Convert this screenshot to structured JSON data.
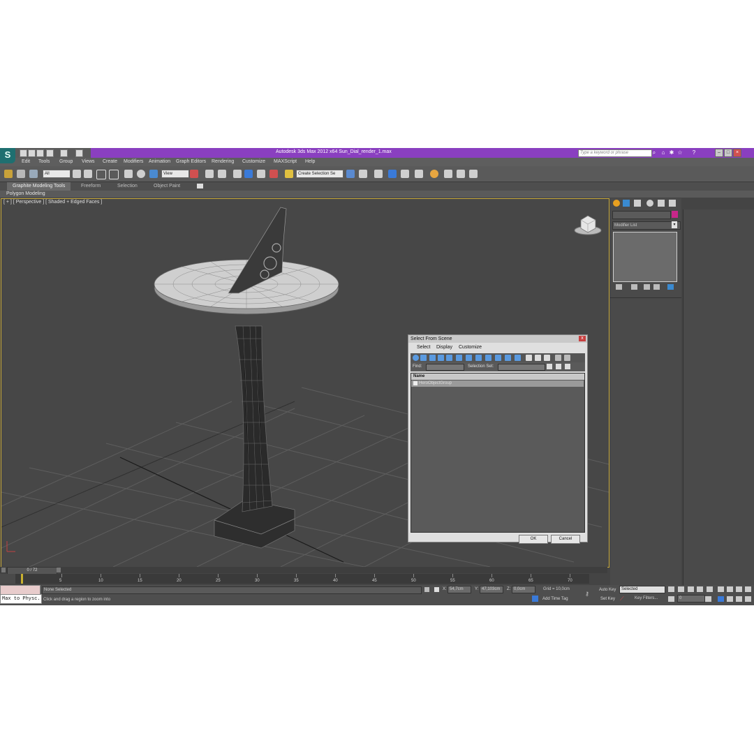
{
  "window": {
    "title": "Autodesk 3ds Max  2012 x64     Sun_Dial_render_1.max",
    "search_placeholder": "Type a keyword or phrase",
    "logo": "S"
  },
  "menu": [
    "Edit",
    "Tools",
    "Group",
    "Views",
    "Create",
    "Modifiers",
    "Animation",
    "Graph Editors",
    "Rendering",
    "Customize",
    "MAXScript",
    "Help"
  ],
  "toolbar": {
    "selection_filter": "All",
    "reference_coord": "View",
    "named_selection_set": "Create Selection Se"
  },
  "ribbon": {
    "tabs": [
      "Graphite Modeling Tools",
      "Freeform",
      "Selection",
      "Object Paint"
    ],
    "sub_label": "Polygon Modeling"
  },
  "viewport": {
    "label": "[ + ] [ Perspective ] [ Shaded + Edged Faces ]"
  },
  "command_panel": {
    "modifier_list": "Modifier List",
    "object_color": "#c8278a"
  },
  "dialog": {
    "title": "Select From Scene",
    "close": "x",
    "menu": [
      "Select",
      "Display",
      "Customize"
    ],
    "find_label": "Find:",
    "selection_set_label": "Selection Set:",
    "column_name": "Name",
    "items": [
      "HeroObjectGroup"
    ],
    "ok": "OK",
    "cancel": "Cancel"
  },
  "timeline": {
    "frame_counter": "0 / 72",
    "ticks": [
      "5",
      "10",
      "15",
      "20",
      "25",
      "30",
      "35",
      "40",
      "45",
      "50",
      "55",
      "60",
      "65",
      "70"
    ]
  },
  "status": {
    "script_listener": "Max to Physc.",
    "selection": "None Selected",
    "prompt": "Click and drag a region to zoom into",
    "x_value": "54,7cm",
    "y_value": "47,103cm",
    "z_value": "0,0cm",
    "grid": "Grid = 10,0cm",
    "add_time_tag": "Add Time Tag",
    "auto_key": "Auto Key",
    "set_key": "Set Key",
    "key_selected": "Selected",
    "key_filters": "Key Filters...",
    "current_frame": "0"
  },
  "colors": {
    "title_bar": "#8a3fc0",
    "viewport_bg": "#474747",
    "viewport_border": "#c8a93a",
    "accent_magenta": "#c8278a"
  }
}
